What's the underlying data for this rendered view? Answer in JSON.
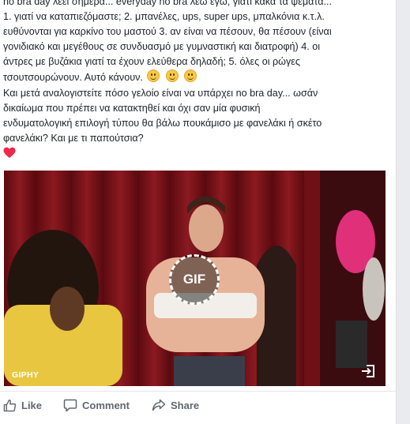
{
  "post": {
    "line1": "no bra day λέει σήμερα... everyday no bra λέω εγώ, γιατί κακά τα ψέματα...",
    "line2": "1. γιατί να καταπιεζόμαστε; 2. μπανέλες, ups, super ups, μπαλκόνια κ.τ.λ.",
    "line3": "ευθύνονται για καρκίνο του μαστού 3. αν είναι να πέσουν, θα πέσουν (είναι",
    "line4": "γονιδιακό και μεγέθους σε συνδυασμό με γυμναστική και διατροφή) 4. οι",
    "line5": "άντρες με βυζάκια γιατί τα έχουν ελεύθερα δηλαδή; 5. όλες οι ρώγες",
    "line6": "τσουτσουρώνουν. Αυτό κάνουν.",
    "line7": "Και μετά αναλογιστείτε πόσο γελοίο είναι να υπάρχει no bra day... ωσάν",
    "line8": "δικαίωμα που πρέπει να κατακτηθεί και όχι σαν μία φυσική",
    "line9": "ενδυματολογική επιλογή τύπου θα βάλω πουκάμισο με φανελάκι ή σκέτο",
    "line10": "φανελάκι? Και με τι παπούτσια?"
  },
  "media": {
    "gif_label": "GIF",
    "source_label": "GIPHY"
  },
  "actions": {
    "like": "Like",
    "comment": "Comment",
    "share": "Share"
  },
  "colors": {
    "text": "#1d2129",
    "action_text": "#606770",
    "heart": "#f0284a",
    "curtain": "#7a1218"
  }
}
